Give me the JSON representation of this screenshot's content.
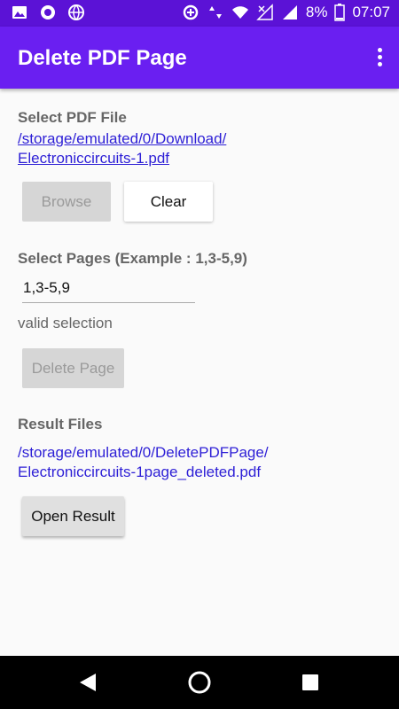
{
  "status_bar": {
    "battery": "8%",
    "time": "07:07",
    "icons_left": [
      "image-icon",
      "circle-icon",
      "globe-icon"
    ],
    "icons_right": [
      "data-saver-icon",
      "data-arrows-icon",
      "wifi-icon",
      "signal-off-icon",
      "signal-icon",
      "battery-icon"
    ]
  },
  "app_bar": {
    "title": "Delete PDF Page",
    "menu_icon": "more-vert-icon"
  },
  "select_file": {
    "label": "Select PDF File",
    "path_line1": "/storage/emulated/0/Download/",
    "path_line2": "Electroniccircuits-1.pdf",
    "browse_label": "Browse",
    "clear_label": "Clear"
  },
  "select_pages": {
    "label": "Select Pages (Example : 1,3-5,9)",
    "value": "1,3-5,9",
    "status": "valid selection",
    "delete_label": "Delete Page"
  },
  "result": {
    "label": "Result Files",
    "path_line1": "/storage/emulated/0/DeletePDFPage/",
    "path_line2": "Electroniccircuits-1page_deleted.pdf",
    "open_label": "Open Result"
  },
  "nav_bar": {
    "icons": [
      "back-icon",
      "home-icon",
      "recents-icon"
    ]
  },
  "colors": {
    "status_bar": "#5b12d6",
    "app_bar": "#6a1ff1",
    "link": "#2d1fd6",
    "disabled_button": "#d6d6d6"
  }
}
